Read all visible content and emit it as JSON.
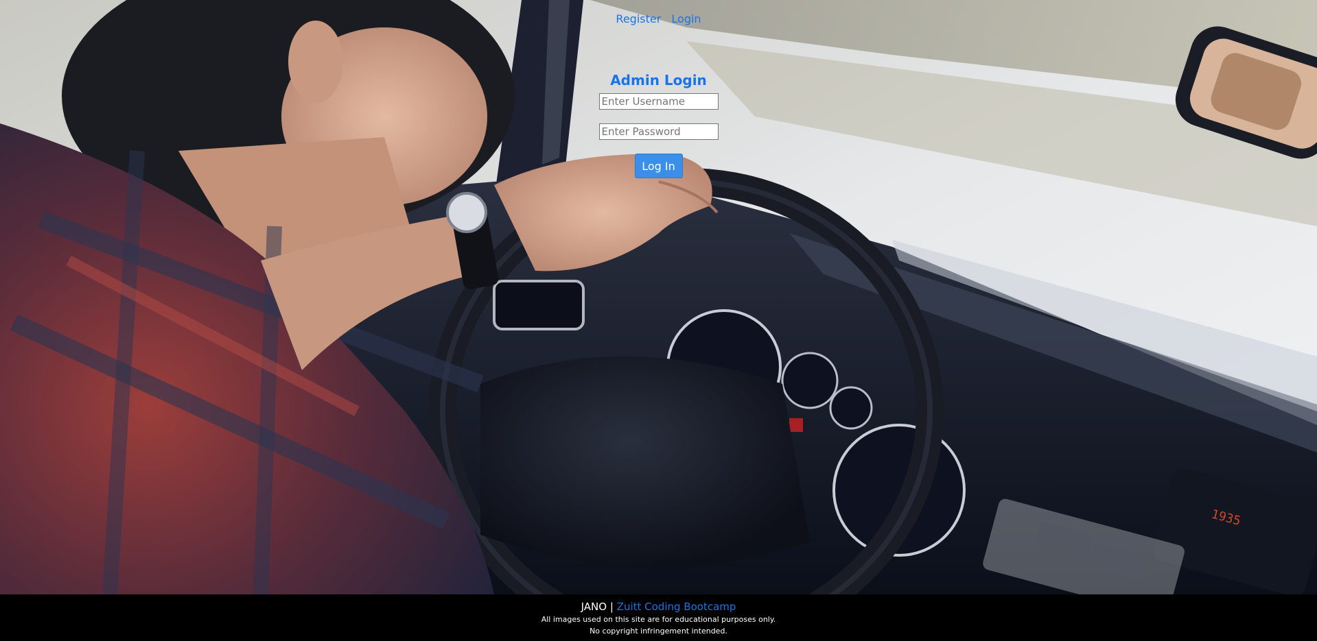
{
  "nav": {
    "register_label": "Register",
    "login_label": "Login"
  },
  "login": {
    "title": "Admin Login",
    "username_placeholder": "Enter Username",
    "password_placeholder": "Enter Password",
    "submit_label": "Log In"
  },
  "footer": {
    "author": "JANO",
    "separator": "|",
    "org_link": "Zuitt Coding Bootcamp",
    "disclaimer_1": "All images used on this site are for educational purposes only.",
    "disclaimer_2": "No copyright infringement intended."
  },
  "colors": {
    "accent": "#1a73e8",
    "button": "#3b8fe8",
    "footer_bg": "#000000"
  }
}
